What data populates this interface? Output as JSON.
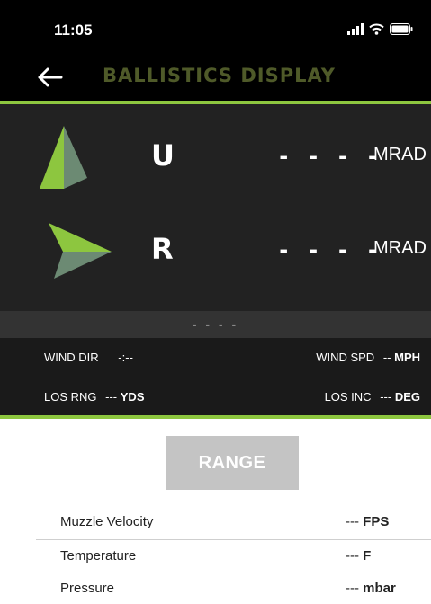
{
  "status_bar": {
    "time": "11:05"
  },
  "header": {
    "title": "BALLISTICS DISPLAY",
    "back_icon": "arrow-left-icon"
  },
  "adjustments": [
    {
      "axis": "U",
      "value": "- - - -",
      "unit": "MRAD",
      "icon": "arrow-up-icon"
    },
    {
      "axis": "R",
      "value": "- - - -",
      "unit": "MRAD",
      "icon": "arrow-right-icon"
    }
  ],
  "status_strip": "- - - -",
  "conditions": {
    "wind_dir": {
      "label": "WIND DIR",
      "value": "-:--"
    },
    "wind_spd": {
      "label": "WIND SPD",
      "value": "--",
      "unit": "MPH"
    },
    "los_rng": {
      "label": "LOS RNG",
      "value": "---",
      "unit": "YDS"
    },
    "los_inc": {
      "label": "LOS INC",
      "value": "---",
      "unit": "DEG"
    }
  },
  "range_button": {
    "label": "RANGE"
  },
  "environment": [
    {
      "label": "Muzzle Velocity",
      "value": "---",
      "unit": "FPS"
    },
    {
      "label": "Temperature",
      "value": "---",
      "unit": "F"
    },
    {
      "label": "Pressure",
      "value": "---",
      "unit": "mbar"
    }
  ],
  "colors": {
    "accent": "#8dc63f",
    "title": "#4f5a29",
    "arrow_light": "#8dc63f",
    "arrow_dark": "#6c8a73"
  }
}
